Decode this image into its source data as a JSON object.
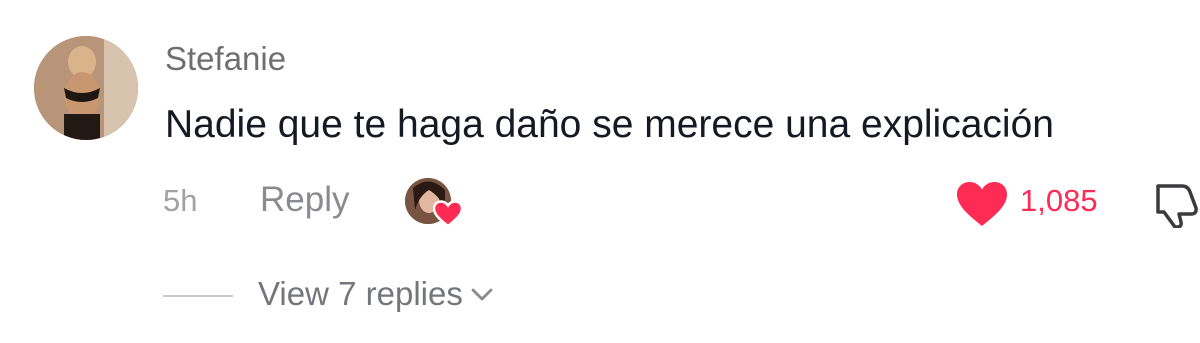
{
  "comment": {
    "username": "Stefanie",
    "text": "Nadie que te haga daño se merece una explicación",
    "time": "5h",
    "reply_label": "Reply",
    "like_count": "1,085",
    "view_replies_label": "View 7 replies"
  },
  "icons": {
    "avatar": "user-avatar",
    "creator_avatar": "creator-avatar",
    "creator_liked": "heart-icon",
    "like": "heart-icon",
    "dislike": "thumbs-down-icon",
    "expand": "chevron-down-icon"
  },
  "colors": {
    "like_red": "#fe2c55",
    "username_gray": "#6f6f6f",
    "text_dark": "#161823",
    "meta_gray": "#8a8b91"
  }
}
